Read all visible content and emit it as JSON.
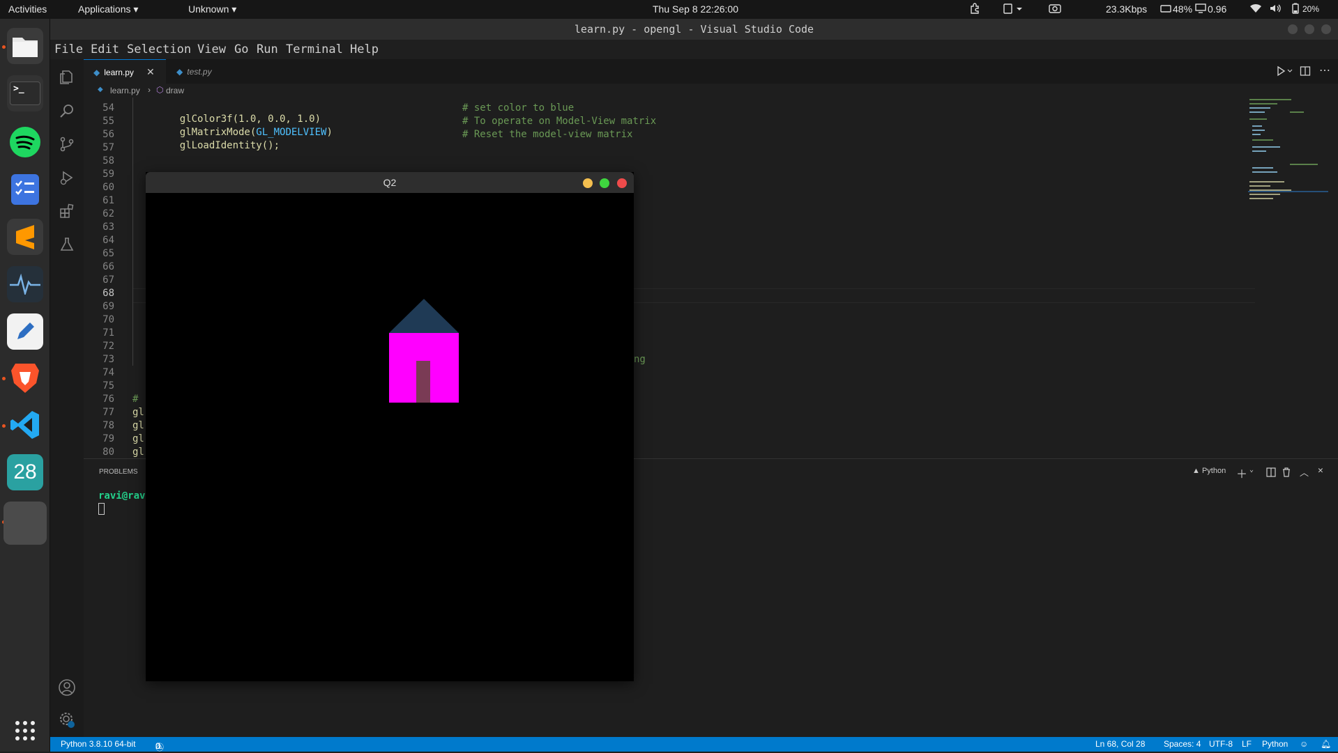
{
  "topbar": {
    "activities": "Activities",
    "applications": "Applications ▾",
    "workspace": "Unknown ▾",
    "clock": "Thu Sep 8 22:26:00",
    "netspeed": "23.3Kbps",
    "cpu": "48%",
    "load": "0.96",
    "battery": "20%"
  },
  "dock": {
    "terminal_label": ">_",
    "calendar_label": "28"
  },
  "window": {
    "title": "learn.py - opengl - Visual Studio Code"
  },
  "menu": [
    "File",
    "Edit",
    "Selection",
    "View",
    "Go",
    "Run",
    "Terminal",
    "Help"
  ],
  "tabs": [
    {
      "label": "learn.py",
      "active": true
    },
    {
      "label": "test.py",
      "active": false
    }
  ],
  "breadcrumb": {
    "file": "learn.py",
    "symbol": "draw"
  },
  "editor": {
    "line_numbers": [
      "54",
      "55",
      "56",
      "57",
      "58",
      "59",
      "60",
      "61",
      "62",
      "63",
      "64",
      "65",
      "66",
      "67",
      "68",
      "69",
      "70",
      "71",
      "72",
      "73",
      "74",
      "75",
      "76",
      "77",
      "78",
      "79",
      "80"
    ],
    "current_line": "68",
    "code": [
      {
        "fn": "glColor3f(1.0, 0.0, 1.0)",
        "comment": "# set color to blue"
      },
      {
        "fn": "glMatrixMode(",
        "const": "GL_MODELVIEW",
        "close": ")",
        "comment": "# To operate on Model-View matrix"
      },
      {
        "fn": "glLoadIdentity();",
        "comment": "# Reset the model-view matrix"
      }
    ],
    "fragment_73": "ng",
    "fragment_76": "# ",
    "fragment_77": "gl",
    "fragment_78": "gl",
    "fragment_79": "gl",
    "fragment_80": "gl"
  },
  "panel": {
    "tab": "PROBLEMS",
    "shell": "Python",
    "prompt": "ravi@ravi"
  },
  "q2": {
    "title": "Q2"
  },
  "status": {
    "interpreter": "Python 3.8.10 64-bit",
    "errors": "0",
    "warnings": "0",
    "position": "Ln 68, Col 28",
    "spaces": "Spaces: 4",
    "encoding": "UTF-8",
    "eol": "LF",
    "language": "Python"
  },
  "colors": {
    "accent": "#007acc",
    "house_body": "#ff00ff",
    "house_roof": "#1f3a55",
    "house_door": "#7a3b55"
  }
}
